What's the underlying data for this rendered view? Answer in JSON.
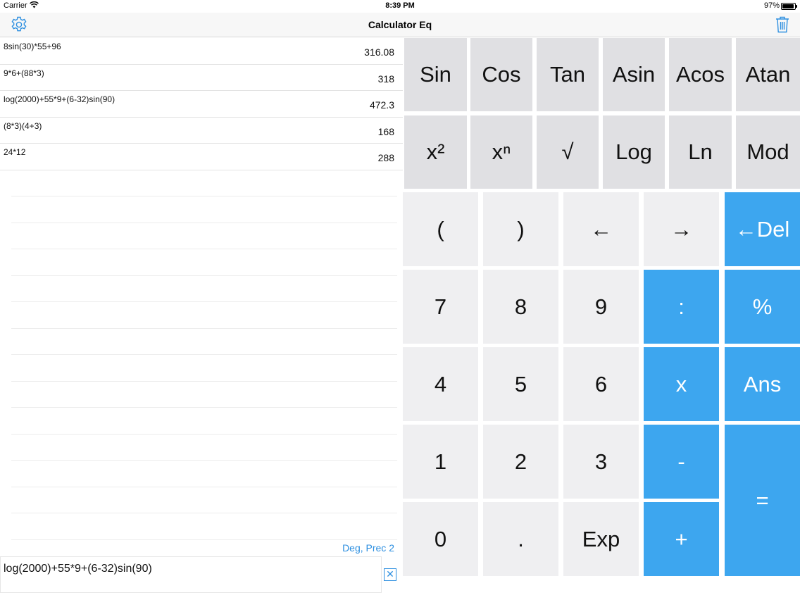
{
  "status": {
    "carrier": "Carrier",
    "time": "8:39 PM",
    "battery": "97%"
  },
  "nav": {
    "title": "Calculator Eq"
  },
  "history": [
    {
      "expr": "8sin(30)*55+96",
      "result": "316.08"
    },
    {
      "expr": "9*6+(88*3)",
      "result": "318"
    },
    {
      "expr": "log(2000)+55*9+(6-32)sin(90)",
      "result": "472.3"
    },
    {
      "expr": "(8*3)(4+3)",
      "result": "168"
    },
    {
      "expr": "24*12",
      "result": "288"
    }
  ],
  "mode_label": "Deg, Prec 2",
  "input": {
    "expression": "log(2000)+55*9+(6-32)sin(90)",
    "clear_symbol": "✕"
  },
  "keys": {
    "sin": "Sin",
    "cos": "Cos",
    "tan": "Tan",
    "asin": "Asin",
    "acos": "Acos",
    "atan": "Atan",
    "square": "x²",
    "power": "xⁿ",
    "sqrt": "√",
    "log": "Log",
    "ln": "Ln",
    "mod": "Mod",
    "lparen": "(",
    "rparen": ")",
    "left": "←",
    "right": "→",
    "del": "←Del",
    "k7": "7",
    "k8": "8",
    "k9": "9",
    "divide": ":",
    "percent": "%",
    "k4": "4",
    "k5": "5",
    "k6": "6",
    "multiply": "x",
    "ans": "Ans",
    "k1": "1",
    "k2": "2",
    "k3": "3",
    "minus": "-",
    "equals": "=",
    "k0": "0",
    "dot": ".",
    "exp": "Exp",
    "plus": "+"
  },
  "colors": {
    "accent": "#3da6ef",
    "link": "#2d8fe0",
    "sci_key": "#e0e0e3",
    "num_key": "#efeff1"
  }
}
